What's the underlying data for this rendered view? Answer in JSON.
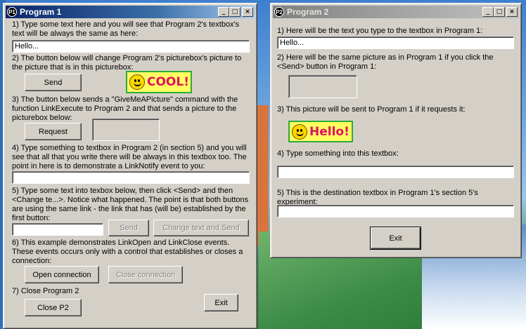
{
  "program1": {
    "title": "Program 1",
    "icon_text": "P1",
    "controls": {
      "minimize": "_",
      "maximize": "□",
      "close": "×"
    },
    "section1_text": "1) Type some text here and you will see that Program 2's textbox's text will be always the same as here:",
    "section1_value": "Hello...",
    "section2_text": "2) The button below will change Program 2's picturebox's picture to the picture that is in this picturebox:",
    "send_label": "Send",
    "picture_word": "COOL!",
    "section3_text": "3) The button below sends a \"GiveMeAPicture\" command with the function LinkExecute to Program 2 and that sends a picture to the picturebox below:",
    "request_label": "Request",
    "section4_text": "4) Type something to textbox in Program 2 (in section 5) and you will see that all that you write there will be always in this textbox too. The point in here is to demonstrate a LinkNotify event to you:",
    "section4_value": "",
    "section5_text": "5) Type some text into texbox below, then click <Send> and then <Change te...>. Notice what happened. The point is that both buttons are using the same link - the link that has (will be) established by the first button:",
    "section5_value": "",
    "send2_label": "Send",
    "change_label": "Change text and Send",
    "section6_text": "6) This example demonstrates LinkOpen and LinkClose events. These events occurs only with a control that establishes or closes a connection:",
    "open_label": "Open connection",
    "close_conn_label": "Close connection",
    "section7_text": "7) Close Program 2",
    "closep2_label": "Close P2",
    "exit_label": "Exit"
  },
  "program2": {
    "title": "Program 2",
    "icon_text": "P2",
    "controls": {
      "minimize": "_",
      "maximize": "□",
      "close": "×"
    },
    "section1_text": "1) Here will be the text you type to the textbox in Program 1:",
    "section1_value": "Hello...",
    "section2_text": "2) Here will be the same picture as in Program 1 if you click the <Send> button in Program 1:",
    "section3_text": "3) This picture will be sent to Program 1 if it requests it:",
    "picture_word": "Hello!",
    "section4_text": "4) Type something into this textbox:",
    "section4_value": "",
    "section5_text": "5) This is the destination textbox in Program 1's section 5's experiment:",
    "section5_value": "",
    "exit_label": "Exit"
  }
}
